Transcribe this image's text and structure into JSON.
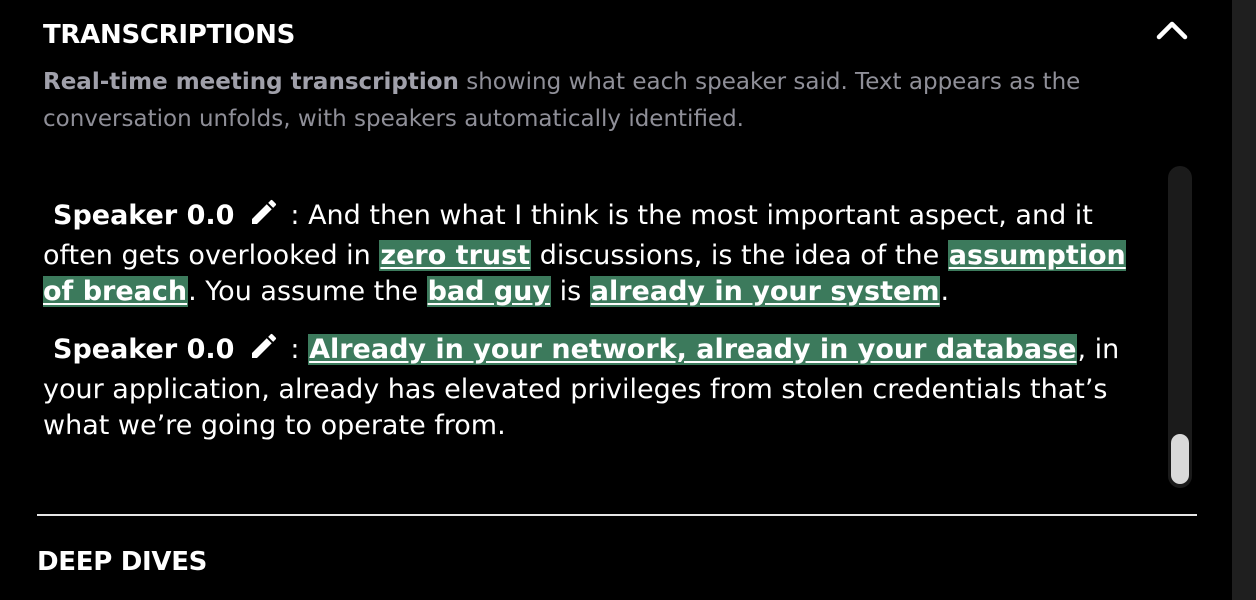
{
  "transcriptions": {
    "title": "TRANSCRIPTIONS",
    "description_bold": "Real-time meeting transcription",
    "description_rest": " showing what each speaker said. Text appears as the conversation unfolds, with speakers automatically identified.",
    "collapse_icon": "chevron-up-icon",
    "entries": [
      {
        "speaker": "Speaker 0.0",
        "edit_icon": "pencil-icon",
        "segments": [
          ": And then what I think is the most important aspect, and it often gets overlooked in ",
          "zero trust",
          " discussions, is the idea of the ",
          "assumption of breach",
          ". You assume the ",
          "bad guy",
          " is ",
          "already in your system",
          "."
        ]
      },
      {
        "speaker": "Speaker 0.0",
        "edit_icon": "pencil-icon",
        "segments": [
          ": ",
          "Already in your network, already in your database",
          ", in your application, already has elevated privileges from stolen credentials that’s what we’re going to operate from."
        ]
      }
    ],
    "highlight_color": "#3c7a5c"
  },
  "deep_dives": {
    "title": "DEEP DIVES"
  }
}
